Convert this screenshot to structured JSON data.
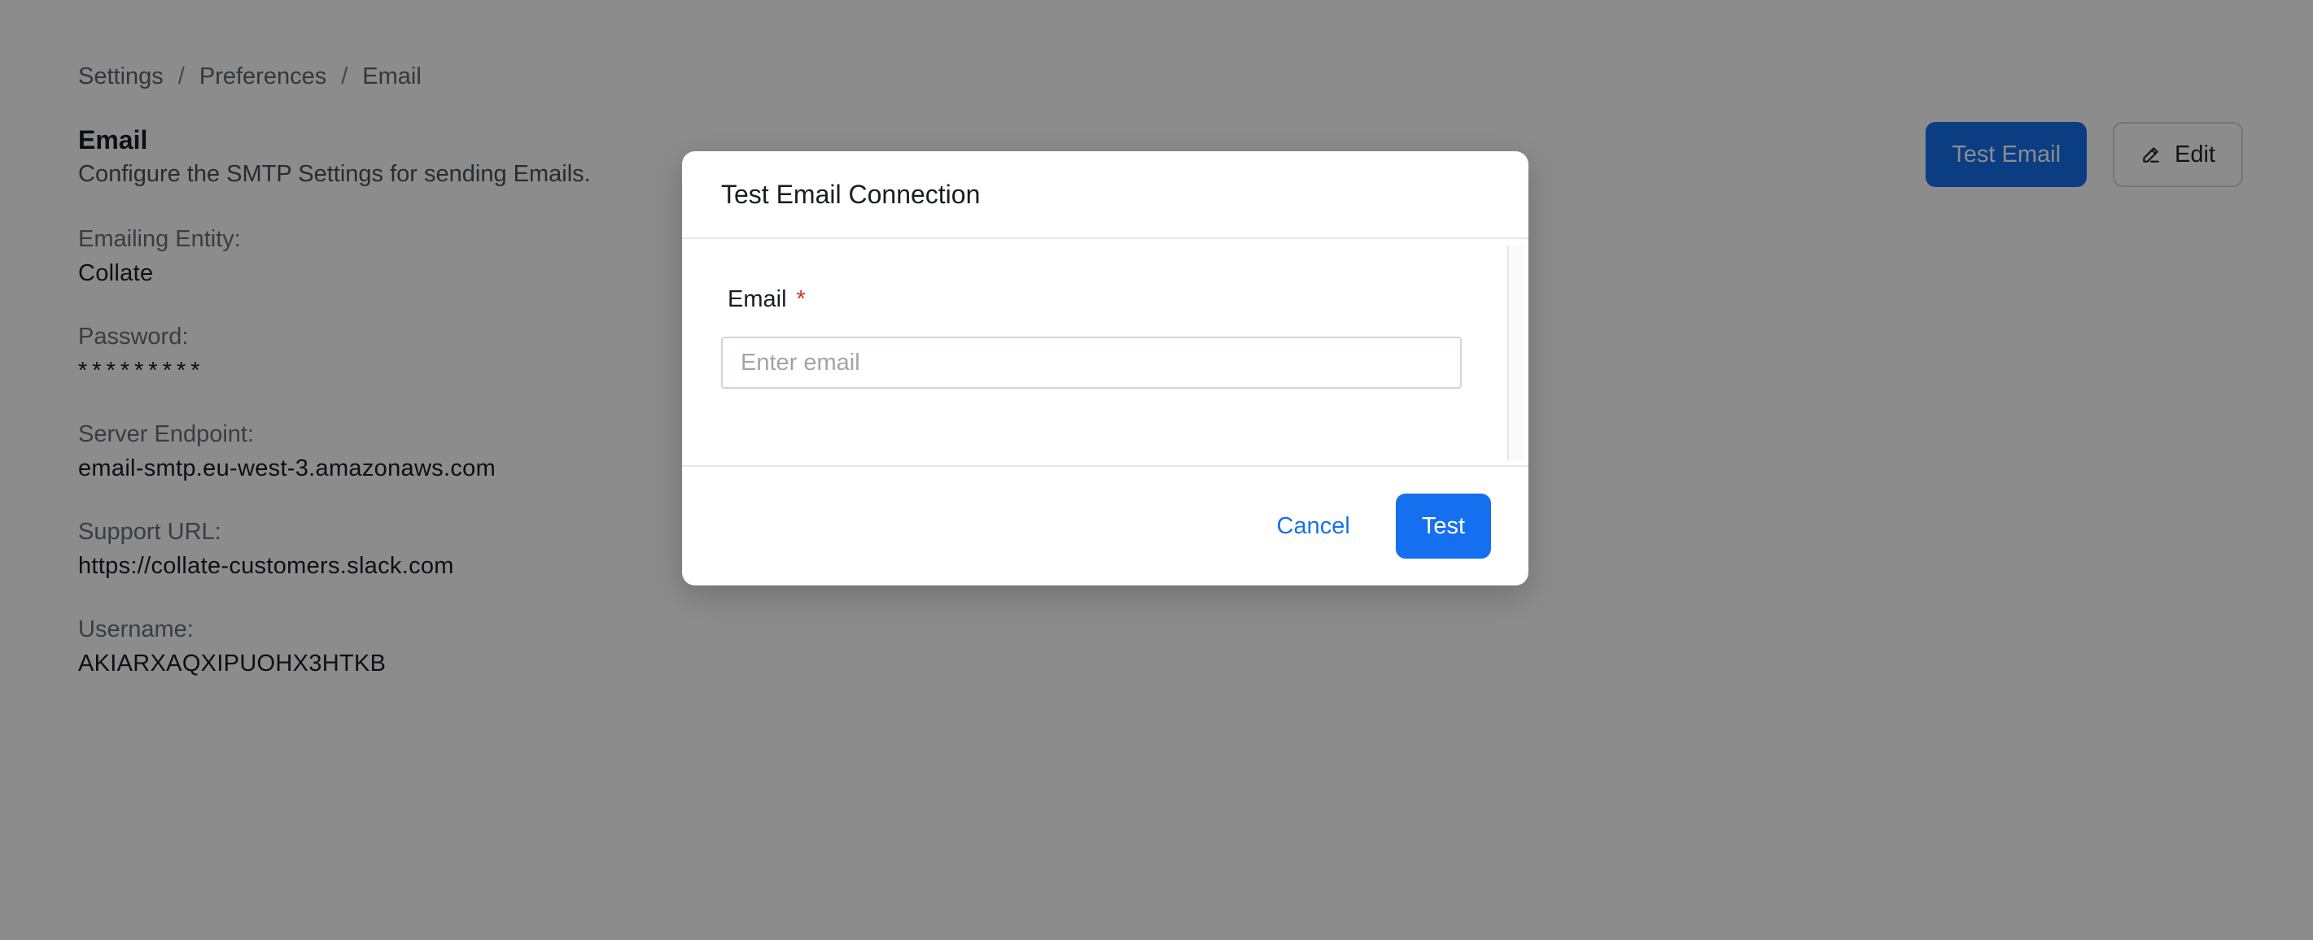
{
  "breadcrumb": {
    "items": [
      "Settings",
      "Preferences",
      "Email"
    ],
    "separator": "/"
  },
  "header": {
    "title": "Email",
    "subtitle": "Configure the SMTP Settings for sending Emails.",
    "test_email_label": "Test Email",
    "edit_label": "Edit"
  },
  "fields": [
    {
      "label": "Emailing Entity:",
      "value": "Collate"
    },
    {
      "label": "Password:",
      "value": "*********"
    },
    {
      "label": "Server Endpoint:",
      "value": "email-smtp.eu-west-3.amazonaws.com"
    },
    {
      "label": "Support URL:",
      "value": "https://collate-customers.slack.com"
    },
    {
      "label": "Username:",
      "value": "AKIARXAQXIPUOHX3HTKB"
    }
  ],
  "modal": {
    "title": "Test Email Connection",
    "email_label": "Email",
    "required_mark": "*",
    "email_placeholder": "Enter email",
    "email_value": "",
    "cancel_label": "Cancel",
    "test_label": "Test"
  },
  "colors": {
    "primary": "#1570ef",
    "required": "#d92d20",
    "overlay": "rgba(0,0,0,0.45)"
  },
  "icons": {
    "edit": "pencil-icon"
  }
}
